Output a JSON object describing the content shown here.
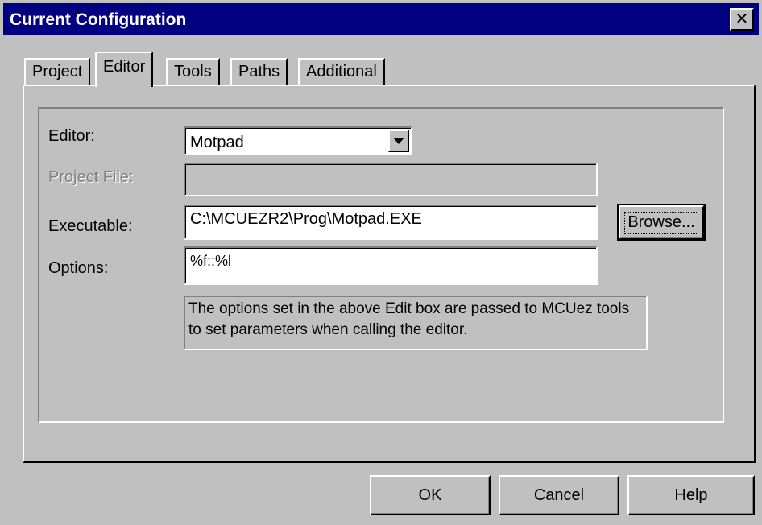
{
  "window": {
    "title": "Current Configuration",
    "close_glyph": "✕"
  },
  "tabs": [
    {
      "label": "Project",
      "active": false
    },
    {
      "label": "Editor",
      "active": true
    },
    {
      "label": "Tools",
      "active": false
    },
    {
      "label": "Paths",
      "active": false
    },
    {
      "label": "Additional",
      "active": false
    }
  ],
  "form": {
    "editor_label": "Editor:",
    "editor_value": "Motpad",
    "project_file_label": "Project File:",
    "project_file_value": "",
    "executable_label": "Executable:",
    "executable_value": "C:\\MCUEZR2\\Prog\\Motpad.EXE",
    "browse_label": "Browse...",
    "options_label": "Options:",
    "options_value": "%f::%l",
    "info_text": "The options set in the above Edit box are passed to MCUez tools to set parameters when calling the editor."
  },
  "buttons": {
    "ok": "OK",
    "cancel": "Cancel",
    "help": "Help"
  },
  "colors": {
    "titlebar": "#000080",
    "face": "#c0c0c0"
  }
}
